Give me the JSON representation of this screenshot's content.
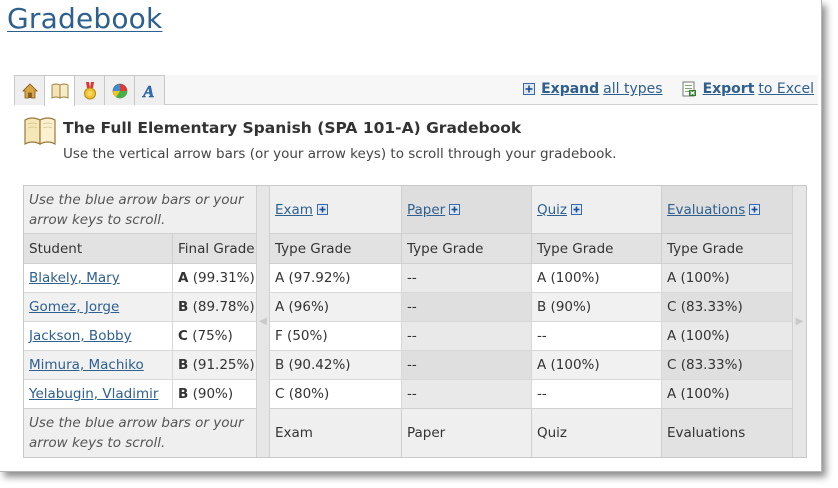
{
  "page": {
    "title": "Gradebook"
  },
  "toolbar": {
    "tabs": [
      {
        "name": "home-icon"
      },
      {
        "name": "book-icon"
      },
      {
        "name": "award-icon"
      },
      {
        "name": "pie-chart-icon"
      },
      {
        "name": "letter-a-icon"
      }
    ],
    "expand": {
      "bold": "Expand",
      "rest": "all types"
    },
    "export": {
      "bold": "Export",
      "rest": "to Excel"
    }
  },
  "header": {
    "heading": "The Full Elementary Spanish (SPA 101-A) Gradebook",
    "subtitle": "Use the vertical arrow bars (or your arrow keys) to scroll through your gradebook."
  },
  "grid": {
    "hint_top": "Use the blue arrow bars or your arrow keys to scroll.",
    "hint_bottom": "Use the blue arrow bars or your arrow keys to scroll.",
    "left_headers": {
      "student": "Student",
      "final": "Final Grade"
    },
    "types": [
      "Exam",
      "Paper",
      "Quiz",
      "Evaluations"
    ],
    "sub_header": "Type Grade",
    "rows": [
      {
        "student": "Blakely, Mary",
        "final_letter": "A",
        "final_pct": "(99.31%)",
        "grades": [
          "A (97.92%)",
          "--",
          "A (100%)",
          "A (100%)"
        ]
      },
      {
        "student": "Gomez, Jorge",
        "final_letter": "B",
        "final_pct": "(89.78%)",
        "grades": [
          "A (96%)",
          "--",
          "B (90%)",
          "C (83.33%)"
        ]
      },
      {
        "student": "Jackson, Bobby",
        "final_letter": "C",
        "final_pct": "(75%)",
        "grades": [
          "F (50%)",
          "--",
          "--",
          "A (100%)"
        ]
      },
      {
        "student": "Mimura, Machiko",
        "final_letter": "B",
        "final_pct": "(91.25%)",
        "grades": [
          "B (90.42%)",
          "--",
          "A (100%)",
          "C (83.33%)"
        ]
      },
      {
        "student": "Yelabugin, Vladimir",
        "final_letter": "B",
        "final_pct": "(90%)",
        "grades": [
          "C (80%)",
          "--",
          "--",
          "A (100%)"
        ]
      }
    ]
  }
}
